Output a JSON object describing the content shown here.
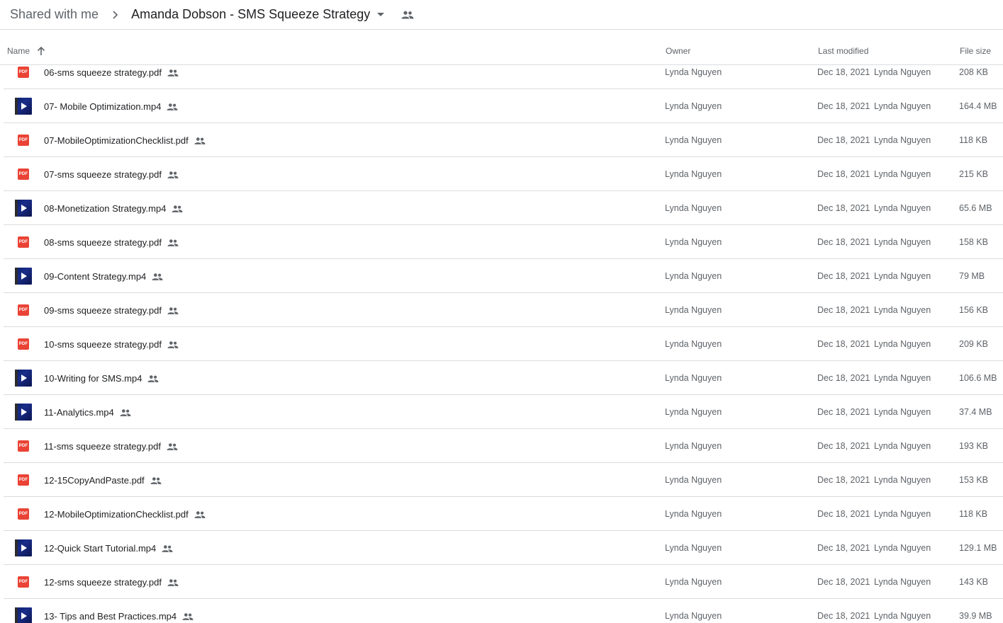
{
  "breadcrumb": {
    "root": "Shared with me",
    "current": "Amanda Dobson - SMS Squeeze Strategy"
  },
  "columns": {
    "name": "Name",
    "owner": "Owner",
    "last_modified": "Last modified",
    "file_size": "File size"
  },
  "files": [
    {
      "type": "pdf",
      "name": "06-sms squeeze strategy.pdf",
      "owner": "Lynda Nguyen",
      "date": "Dec 18, 2021",
      "modified_by": "Lynda Nguyen",
      "size": "208 KB"
    },
    {
      "type": "video",
      "name": "07- Mobile Optimization.mp4",
      "owner": "Lynda Nguyen",
      "date": "Dec 18, 2021",
      "modified_by": "Lynda Nguyen",
      "size": "164.4 MB"
    },
    {
      "type": "pdf",
      "name": "07-MobileOptimizationChecklist.pdf",
      "owner": "Lynda Nguyen",
      "date": "Dec 18, 2021",
      "modified_by": "Lynda Nguyen",
      "size": "118 KB"
    },
    {
      "type": "pdf",
      "name": "07-sms squeeze strategy.pdf",
      "owner": "Lynda Nguyen",
      "date": "Dec 18, 2021",
      "modified_by": "Lynda Nguyen",
      "size": "215 KB"
    },
    {
      "type": "video",
      "name": "08-Monetization Strategy.mp4",
      "owner": "Lynda Nguyen",
      "date": "Dec 18, 2021",
      "modified_by": "Lynda Nguyen",
      "size": "65.6 MB"
    },
    {
      "type": "pdf",
      "name": "08-sms squeeze strategy.pdf",
      "owner": "Lynda Nguyen",
      "date": "Dec 18, 2021",
      "modified_by": "Lynda Nguyen",
      "size": "158 KB"
    },
    {
      "type": "video",
      "name": "09-Content Strategy.mp4",
      "owner": "Lynda Nguyen",
      "date": "Dec 18, 2021",
      "modified_by": "Lynda Nguyen",
      "size": "79 MB"
    },
    {
      "type": "pdf",
      "name": "09-sms squeeze strategy.pdf",
      "owner": "Lynda Nguyen",
      "date": "Dec 18, 2021",
      "modified_by": "Lynda Nguyen",
      "size": "156 KB"
    },
    {
      "type": "pdf",
      "name": "10-sms squeeze strategy.pdf",
      "owner": "Lynda Nguyen",
      "date": "Dec 18, 2021",
      "modified_by": "Lynda Nguyen",
      "size": "209 KB"
    },
    {
      "type": "video",
      "name": "10-Writing for SMS.mp4",
      "owner": "Lynda Nguyen",
      "date": "Dec 18, 2021",
      "modified_by": "Lynda Nguyen",
      "size": "106.6 MB"
    },
    {
      "type": "video",
      "name": "11-Analytics.mp4",
      "owner": "Lynda Nguyen",
      "date": "Dec 18, 2021",
      "modified_by": "Lynda Nguyen",
      "size": "37.4 MB"
    },
    {
      "type": "pdf",
      "name": "11-sms squeeze strategy.pdf",
      "owner": "Lynda Nguyen",
      "date": "Dec 18, 2021",
      "modified_by": "Lynda Nguyen",
      "size": "193 KB"
    },
    {
      "type": "pdf",
      "name": "12-15CopyAndPaste.pdf",
      "owner": "Lynda Nguyen",
      "date": "Dec 18, 2021",
      "modified_by": "Lynda Nguyen",
      "size": "153 KB"
    },
    {
      "type": "pdf",
      "name": "12-MobileOptimizationChecklist.pdf",
      "owner": "Lynda Nguyen",
      "date": "Dec 18, 2021",
      "modified_by": "Lynda Nguyen",
      "size": "118 KB"
    },
    {
      "type": "video",
      "name": "12-Quick Start Tutorial.mp4",
      "owner": "Lynda Nguyen",
      "date": "Dec 18, 2021",
      "modified_by": "Lynda Nguyen",
      "size": "129.1 MB"
    },
    {
      "type": "pdf",
      "name": "12-sms squeeze strategy.pdf",
      "owner": "Lynda Nguyen",
      "date": "Dec 18, 2021",
      "modified_by": "Lynda Nguyen",
      "size": "143 KB"
    },
    {
      "type": "video",
      "name": "13- Tips and Best Practices.mp4",
      "owner": "Lynda Nguyen",
      "date": "Dec 18, 2021",
      "modified_by": "Lynda Nguyen",
      "size": "39.9 MB"
    }
  ],
  "icons": {
    "pdf_label": "PDF",
    "pdf_color": "#ea4335",
    "shared": "people-icon",
    "sort": "arrow-up-icon"
  }
}
